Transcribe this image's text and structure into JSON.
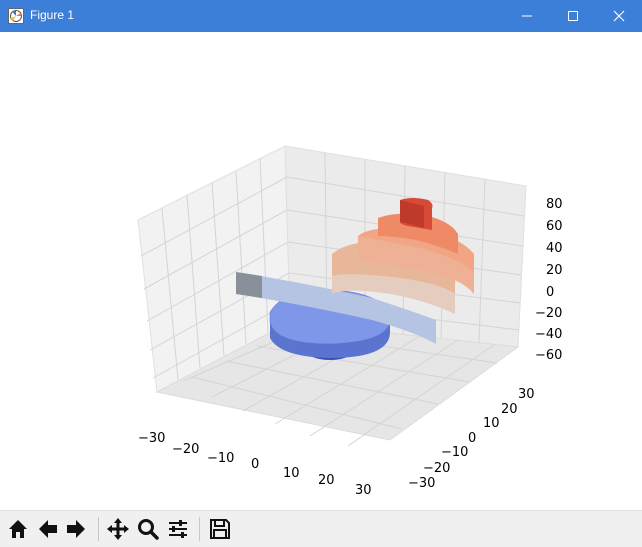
{
  "window": {
    "title": "Figure 1",
    "accent_color": "#3b7fd8",
    "icons": [
      "matplotlib-logo-icon",
      "minimize-icon",
      "maximize-icon",
      "close-icon"
    ]
  },
  "toolbar": {
    "buttons": [
      {
        "name": "home",
        "icon": "home-icon"
      },
      {
        "name": "back",
        "icon": "arrow-left-icon"
      },
      {
        "name": "forward",
        "icon": "arrow-right-icon"
      },
      {
        "name": "pan",
        "icon": "move-icon"
      },
      {
        "name": "zoom",
        "icon": "magnifier-icon"
      },
      {
        "name": "configure-subplots",
        "icon": "sliders-icon"
      },
      {
        "name": "save",
        "icon": "save-icon"
      }
    ]
  },
  "chart_data": {
    "type": "surface-3d",
    "title": "",
    "xlabel": "",
    "ylabel": "",
    "zlabel": "",
    "x_ticks": [
      "−30",
      "−20",
      "−10",
      "0",
      "10",
      "20",
      "30"
    ],
    "y_ticks": [
      "−30",
      "−20",
      "−10",
      "0",
      "10",
      "20",
      "30"
    ],
    "z_ticks": [
      "−60",
      "−40",
      "−20",
      "0",
      "20",
      "40",
      "60",
      "80"
    ],
    "xlim": [
      -33,
      33
    ],
    "ylim": [
      -33,
      33
    ],
    "zlim": [
      -70,
      85
    ],
    "colormap": "coolwarm",
    "grid": true,
    "description_series": [
      {
        "name": "spiral-ribbon",
        "z_range": [
          -60,
          75
        ]
      }
    ]
  }
}
